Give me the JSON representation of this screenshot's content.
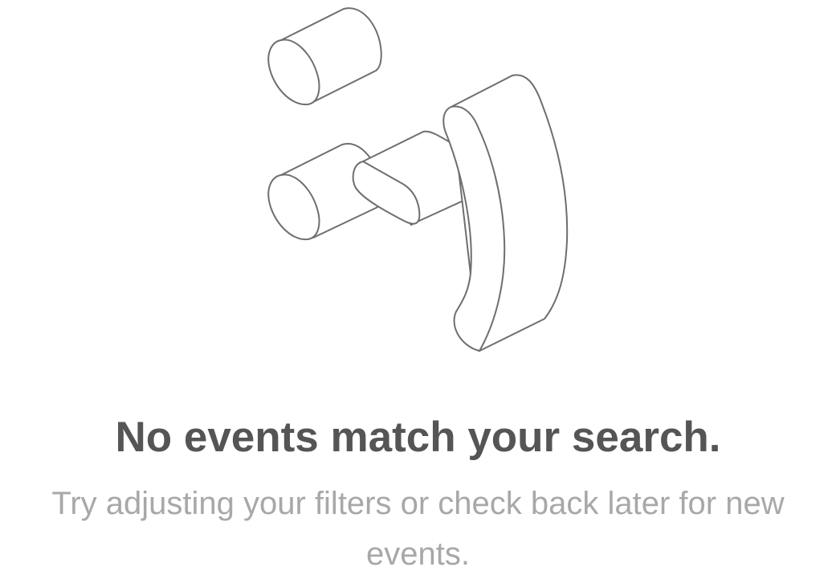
{
  "empty_state": {
    "illustration": "empty-search-illustration",
    "title": "No events match your search.",
    "message": "Try adjusting your filters or check back later for new events."
  },
  "colors": {
    "title": "#555555",
    "message": "#a8a8a8",
    "stroke": "#6e6e6e"
  }
}
